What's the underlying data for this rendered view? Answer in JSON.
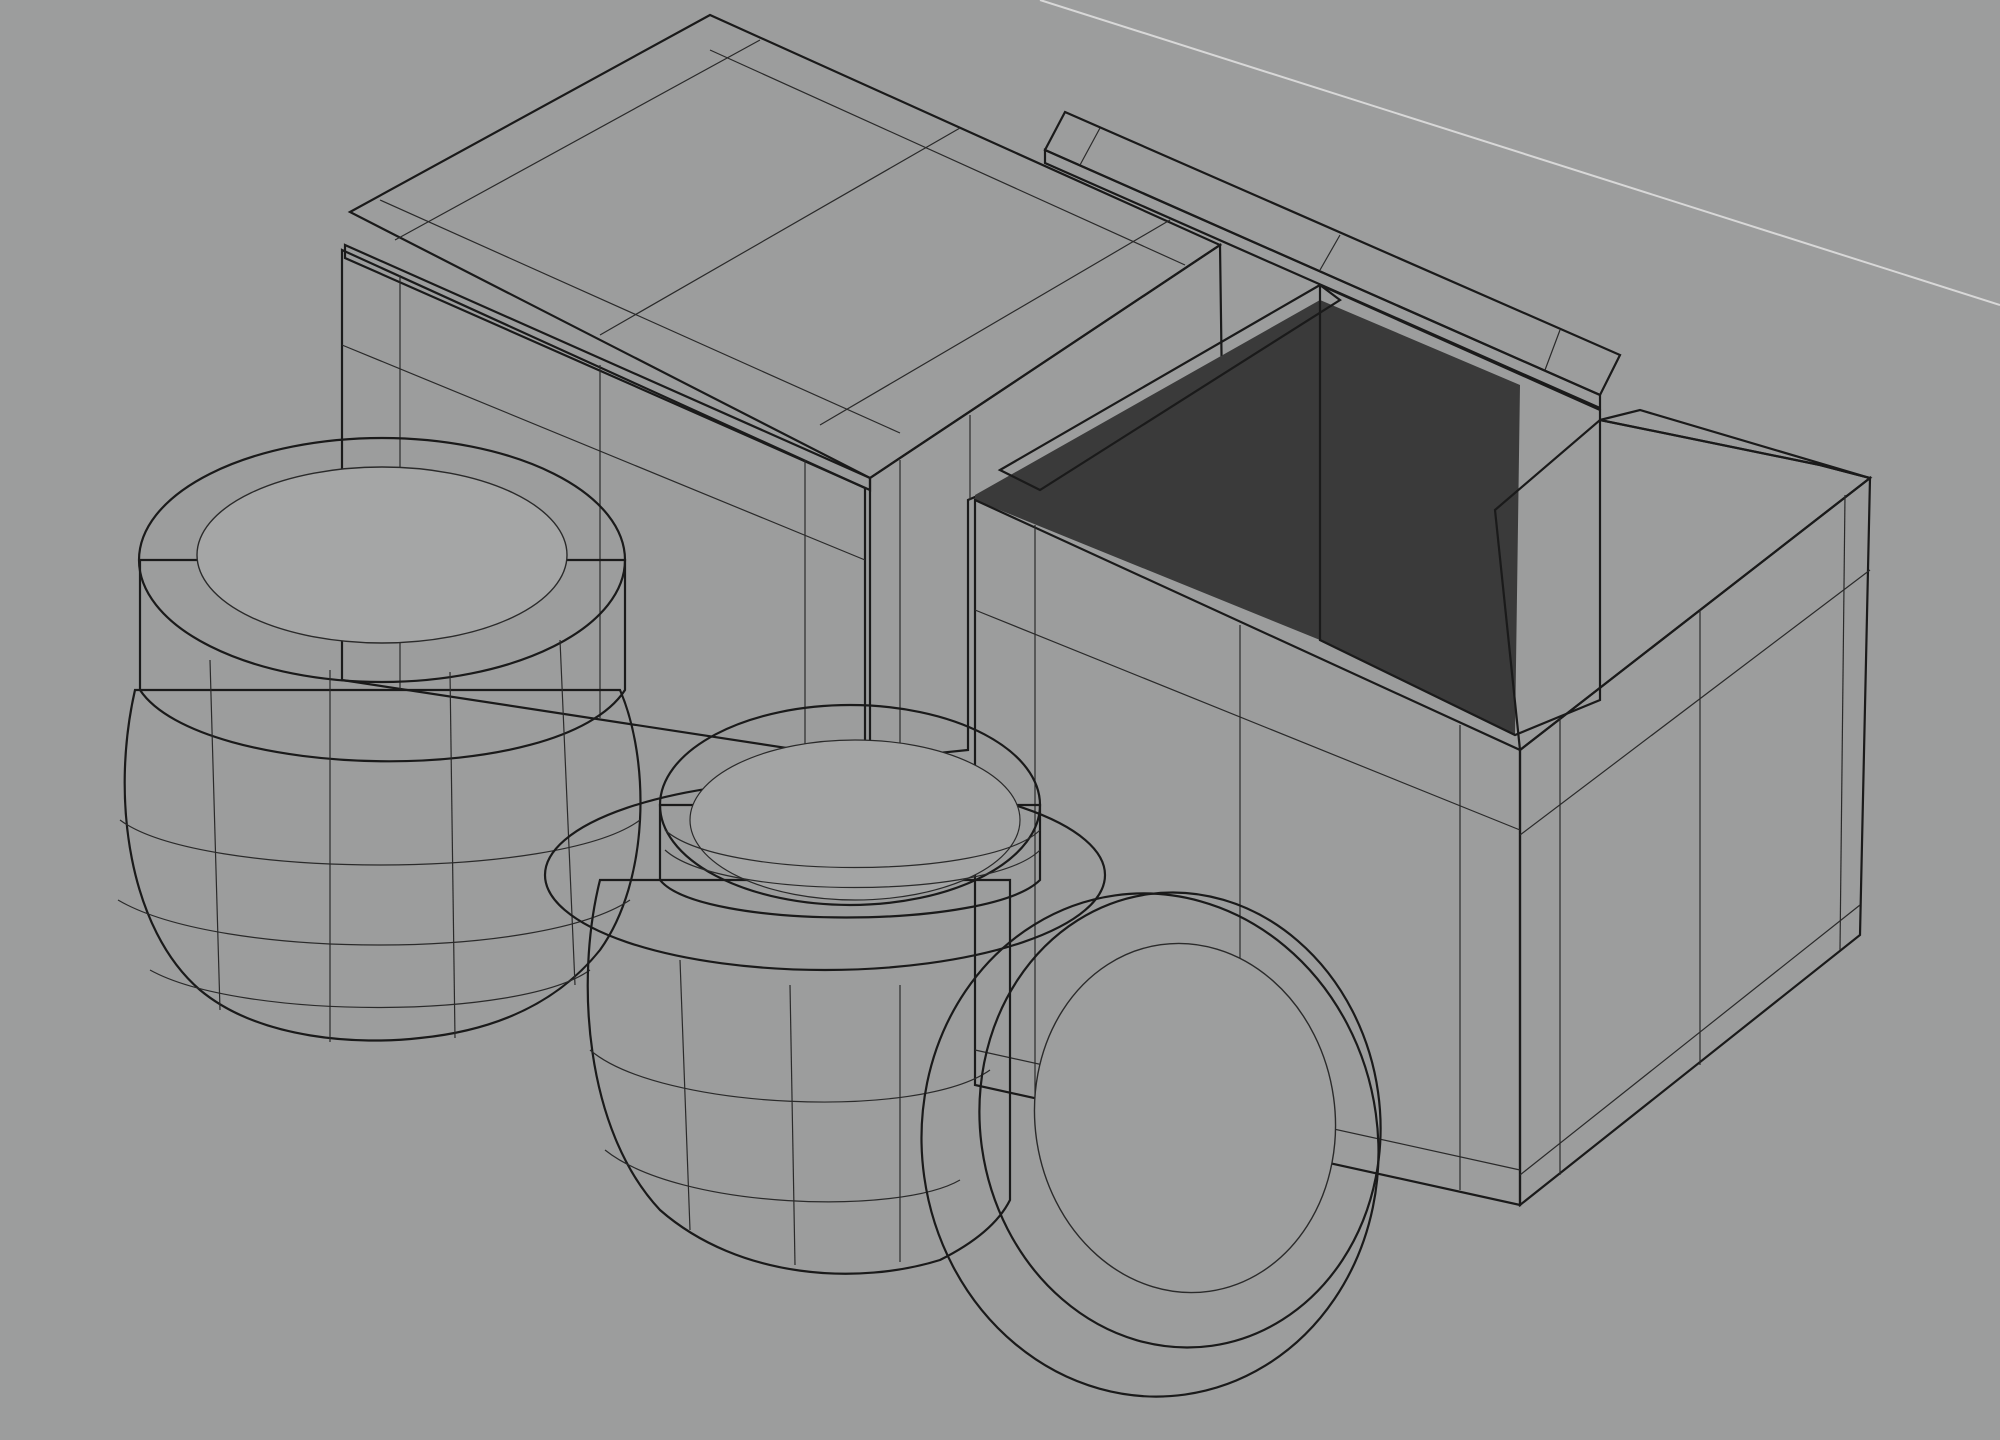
{
  "viewport": {
    "description_colors": {
      "background": "#9c9d9d",
      "surface_light": "#a9aaaa",
      "surface_mid": "#959696",
      "surface_dark": "#7c7d7d",
      "surface_interior": "#3c3c3c",
      "wire": "#2a2a2a"
    },
    "objects": [
      "closed-box",
      "open-box",
      "closed-jar",
      "open-jar",
      "jar-lid"
    ]
  }
}
